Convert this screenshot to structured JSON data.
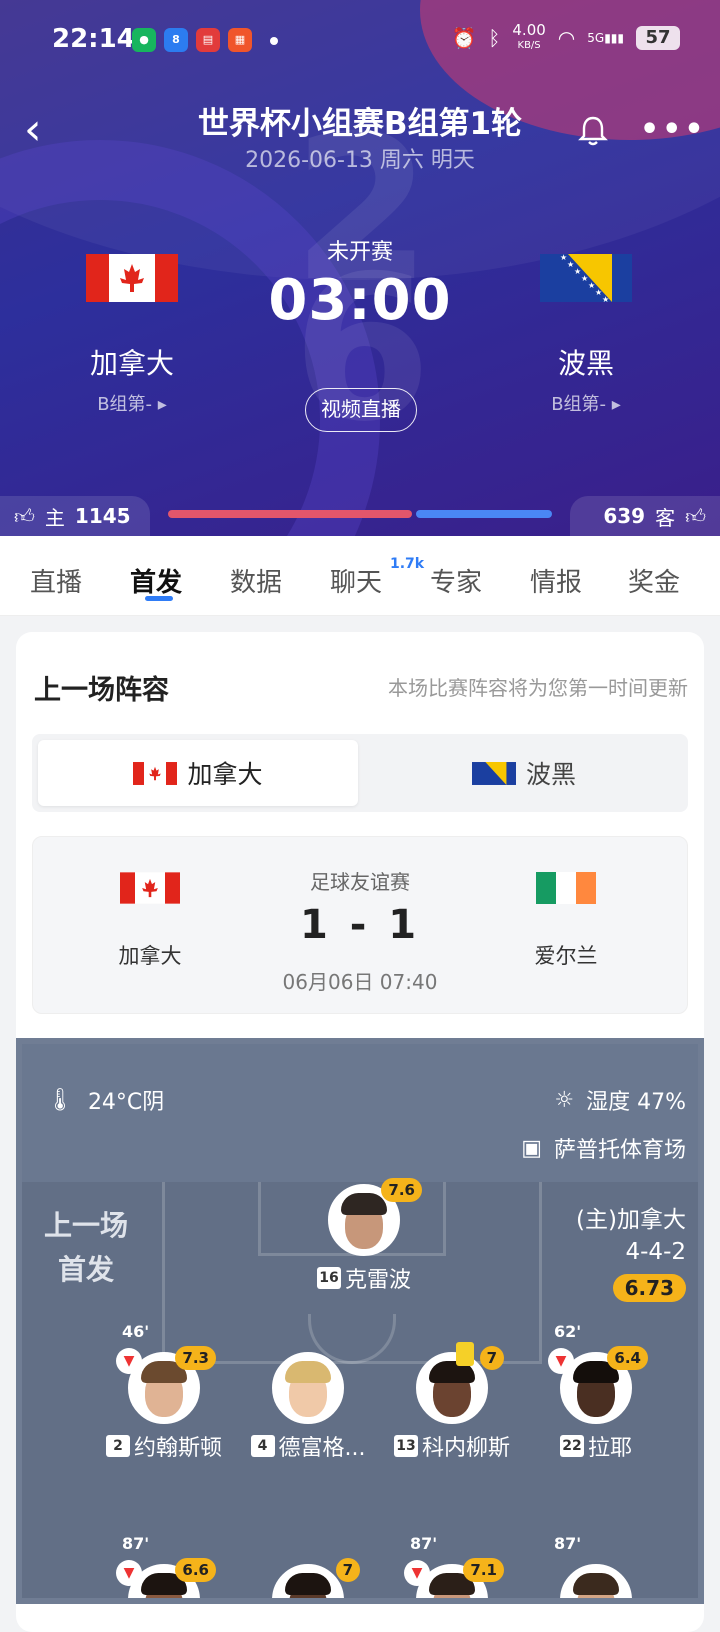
{
  "status_bar": {
    "time": "22:14",
    "net_speed": "4.00",
    "net_unit": "KB/S",
    "signal": "5G",
    "battery": "57"
  },
  "header": {
    "title": "世界杯小组赛B组第1轮",
    "subtitle": "2026-06-13 周六 明天",
    "match_status": "未开赛",
    "kickoff": "03:00",
    "live_button": "视频直播",
    "home": {
      "name": "加拿大",
      "group": "B组第-"
    },
    "away": {
      "name": "波黑",
      "group": "B组第-"
    },
    "votes": {
      "home_label": "主",
      "home_count": "1145",
      "away_label": "客",
      "away_count": "639"
    }
  },
  "tabs": [
    {
      "label": "直播"
    },
    {
      "label": "首发"
    },
    {
      "label": "数据"
    },
    {
      "label": "聊天"
    },
    {
      "label": "专家"
    },
    {
      "label": "情报"
    },
    {
      "label": "奖金"
    }
  ],
  "chat_badge": "1.7k",
  "lineup_card": {
    "title": "上一场阵容",
    "note": "本场比赛阵容将为您第一时间更新",
    "team_tabs": [
      "加拿大",
      "波黑"
    ],
    "prev_match": {
      "competition": "足球友谊赛",
      "score": "1 - 1",
      "datetime": "06月06日 07:40",
      "home": "加拿大",
      "away": "爱尔兰"
    }
  },
  "pitch": {
    "weather": "24°C阴",
    "humidity": "湿度 47%",
    "venue": "萨普托体育场",
    "label_line1": "上一场",
    "label_line2": "首发",
    "team_label": "(主)加拿大",
    "formation": "4-4-2",
    "team_rating": "6.73",
    "players": [
      {
        "number": "16",
        "name": "克雷波",
        "rating": "7.6"
      },
      {
        "number": "2",
        "name": "约翰斯顿",
        "rating": "7.3",
        "minute": "46'"
      },
      {
        "number": "4",
        "name": "德富格...",
        "rating": ""
      },
      {
        "number": "13",
        "name": "科内柳斯",
        "rating": "7"
      },
      {
        "number": "22",
        "name": "拉耶",
        "rating": "6.4",
        "minute": "62'"
      }
    ],
    "row3": [
      {
        "rating": "6.6",
        "minute": "87'"
      },
      {
        "rating": "7",
        "minute": ""
      },
      {
        "rating": "7.1",
        "minute": "87'"
      },
      {
        "rating": "",
        "minute": "87'"
      }
    ]
  },
  "colors": {
    "accent": "#2f7cf6",
    "rating": "#f5b31a",
    "home_bar": "#e2566b",
    "away_bar": "#4a87f5"
  }
}
